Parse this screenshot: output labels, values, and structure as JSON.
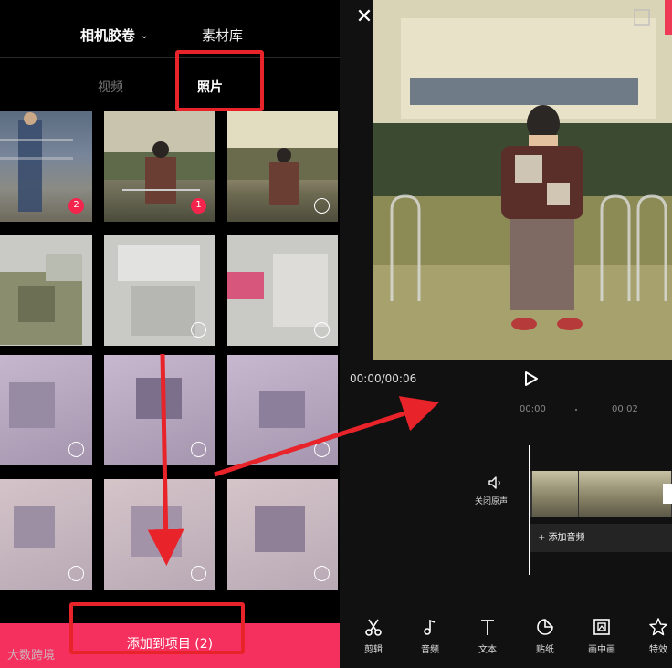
{
  "album_picker": {
    "top_tabs": {
      "camera_roll": "相机胶卷",
      "material_library": "素材库"
    },
    "sub_tabs": {
      "video": "视频",
      "photo": "照片"
    },
    "selection_badges": [
      "2",
      "1"
    ],
    "add_button": "添加到项目 (2)"
  },
  "watermark": "大数跨境",
  "editor": {
    "time": "00:00/00:06",
    "ruler": [
      "00:00",
      "00:02"
    ],
    "mute_label": "关闭原声",
    "add_audio": "+ 添加音频",
    "tools": [
      {
        "label": "剪辑",
        "icon": "scissors-icon"
      },
      {
        "label": "音频",
        "icon": "music-note-icon"
      },
      {
        "label": "文本",
        "icon": "text-icon"
      },
      {
        "label": "贴纸",
        "icon": "sticker-icon"
      },
      {
        "label": "画中画",
        "icon": "picture-in-picture-icon"
      },
      {
        "label": "特效",
        "icon": "effects-star-icon"
      }
    ]
  },
  "colors": {
    "accent": "#f5305f",
    "highlight": "#e8232a",
    "badge": "#f3254d"
  }
}
